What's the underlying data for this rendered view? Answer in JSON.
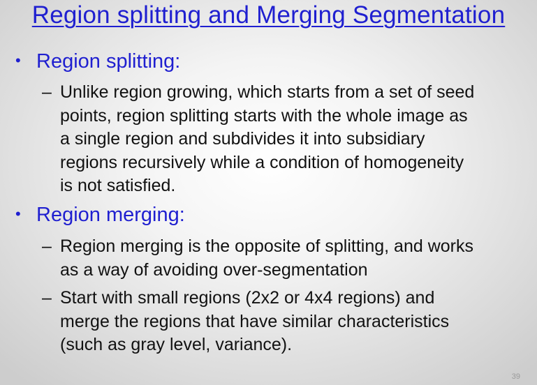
{
  "title": "Region splitting and Merging Segmentation",
  "sections": [
    {
      "heading": "Region splitting:",
      "bullet_symbol": "•",
      "points": [
        {
          "dash": "–",
          "text": "Unlike region growing, which starts from a set of seed\npoints, region splitting starts with the whole image as\na single region and subdivides it into subsidiary\nregions recursively while a condition of homogeneity\nis not satisfied."
        }
      ]
    },
    {
      "heading": "Region merging:",
      "bullet_symbol": "•",
      "points": [
        {
          "dash": "–",
          "text": "Region merging is the opposite of splitting, and works\nas a way of avoiding over-segmentation"
        },
        {
          "dash": "–",
          "text": "Start with small regions (2x2 or 4x4 regions) and\nmerge the regions that have similar characteristics\n(such as gray level, variance)."
        }
      ]
    }
  ],
  "page_number": "39"
}
